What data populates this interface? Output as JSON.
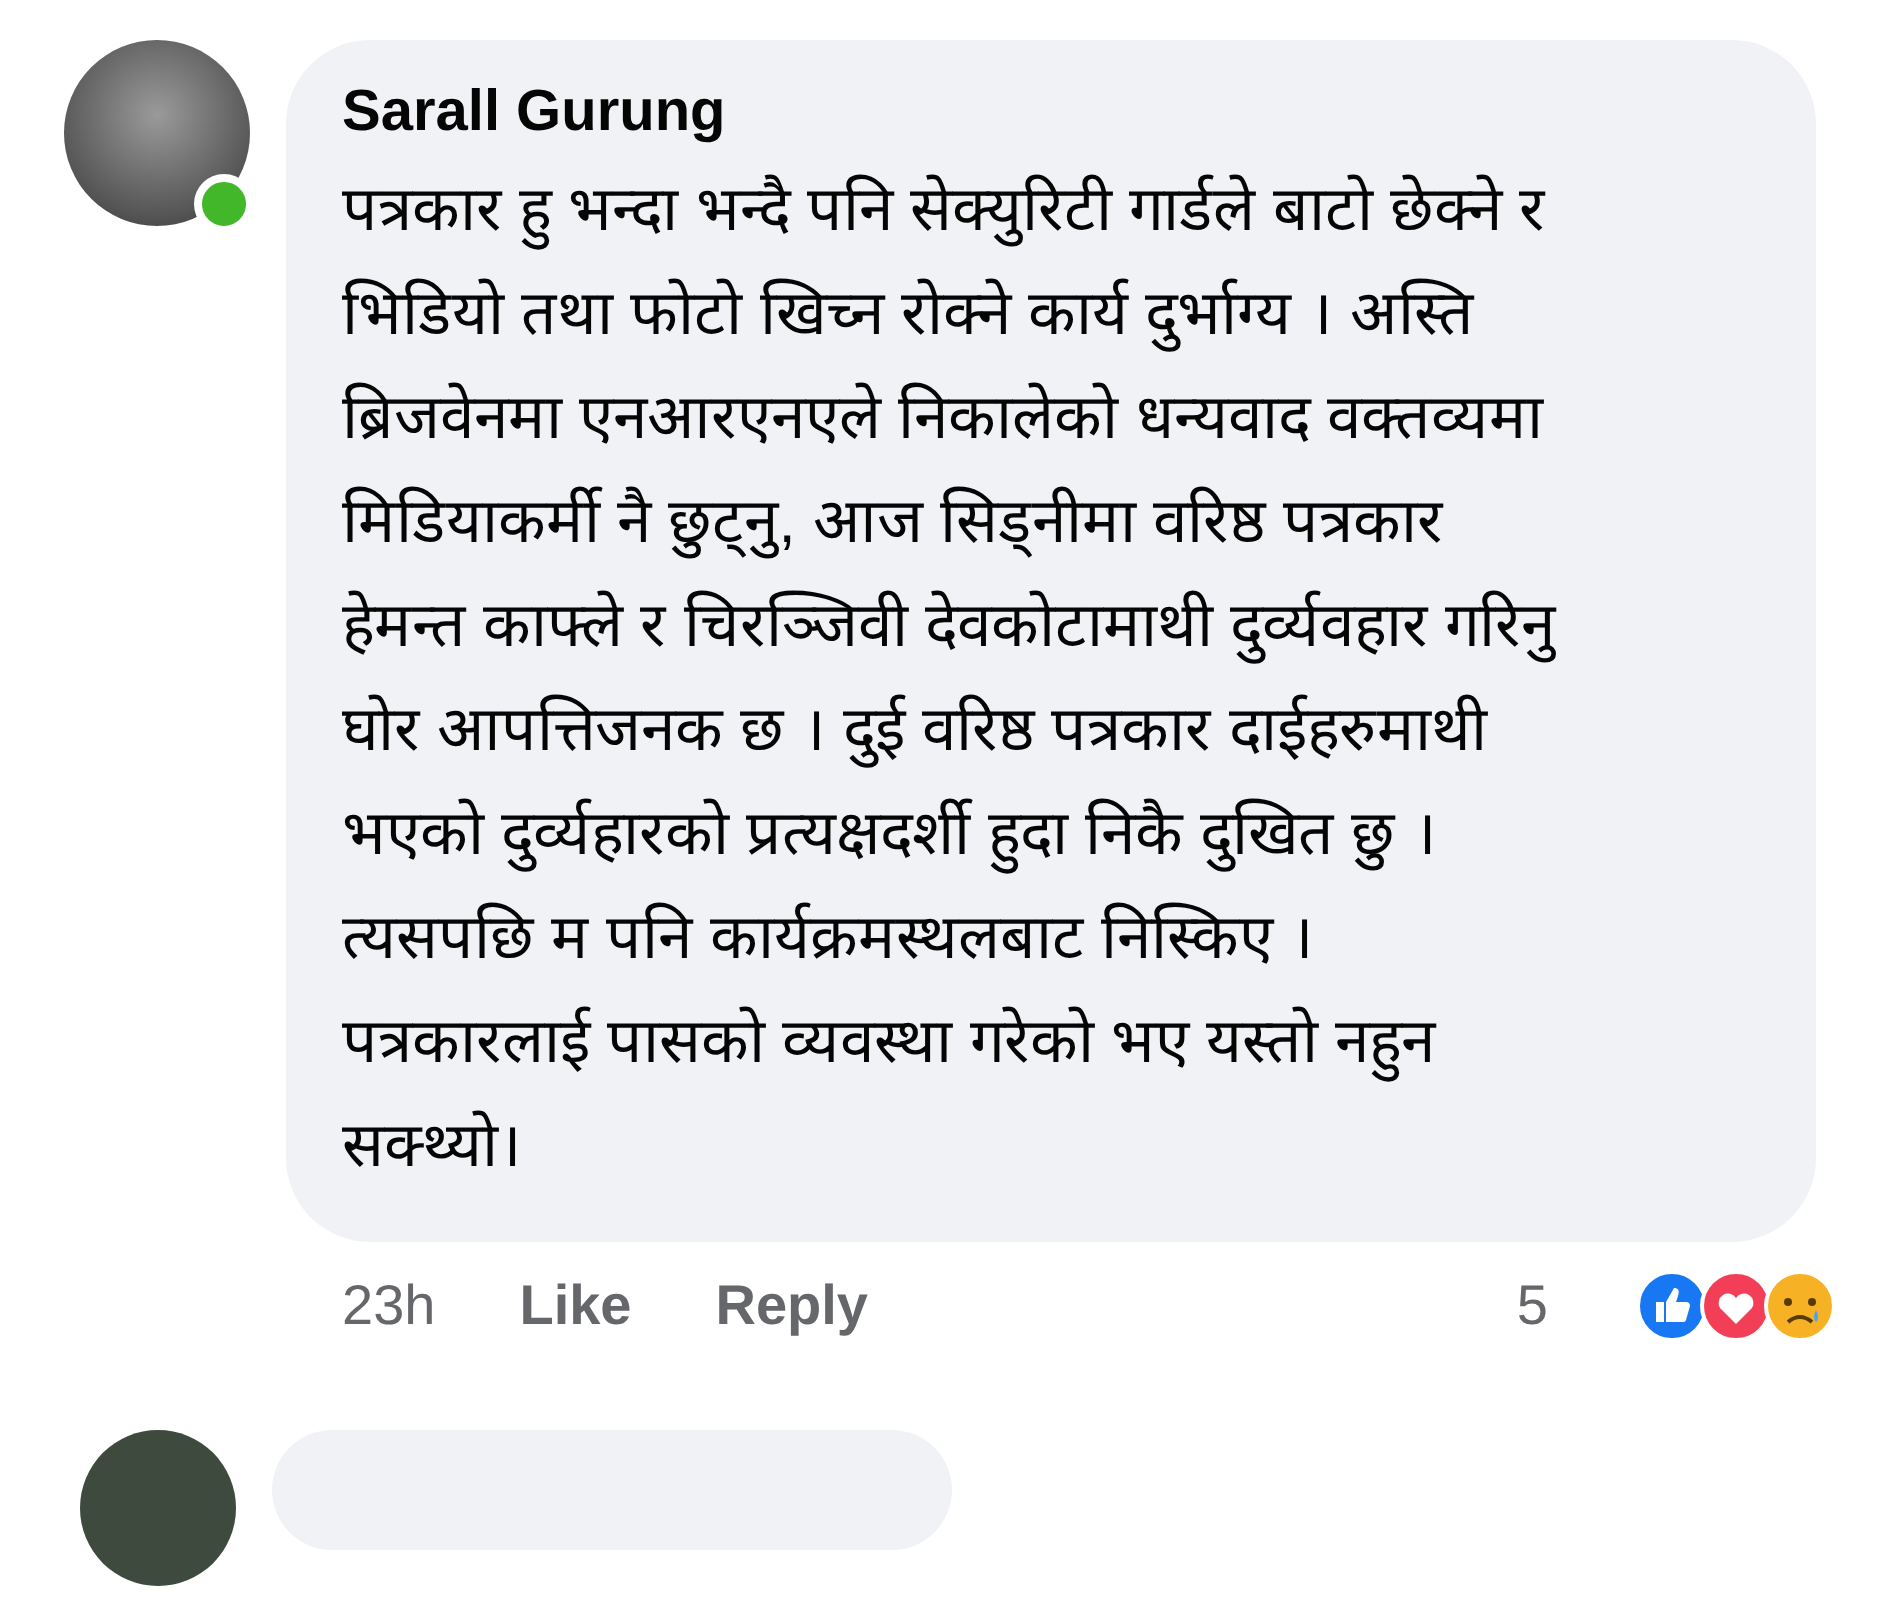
{
  "comment": {
    "author": "Sarall Gurung",
    "online": true,
    "text": "पत्रकार हु भन्दा भन्दै पनि सेक्युरिटी गार्डले बाटो छेक्ने र\nभिडियो तथा फोटो खिच्न रोक्ने कार्य दुर्भाग्य । अस्ति\nब्रिजवेनमा एनआरएनएले निकालेको धन्यवाद वक्तव्यमा\nमिडियाकर्मी नै छुट्नु, आज सिड्नीमा वरिष्ठ पत्रकार\nहेमन्त काफ्ले र चिरञ्जिवी देवकोटामाथी दुर्व्यवहार गरिनु\nघोर आपत्तिजनक छ । दुई वरिष्ठ पत्रकार दाईहरुमाथी\nभएको दुर्व्यहारको प्रत्यक्षदर्शी हुदा निकै दुखित छु ।\nत्यसपछि म पनि कार्यक्रमस्थलबाट निस्किए ।\nपत्रकारलाई पासको व्यवस्था गरेको भए यस्तो नहुन\nसक्थ्यो।",
    "time": "23h",
    "actions": [
      "Like",
      "Reply"
    ],
    "reaction_count": "5",
    "reactions": [
      {
        "kind": "like"
      },
      {
        "kind": "love"
      },
      {
        "kind": "sad"
      }
    ]
  }
}
